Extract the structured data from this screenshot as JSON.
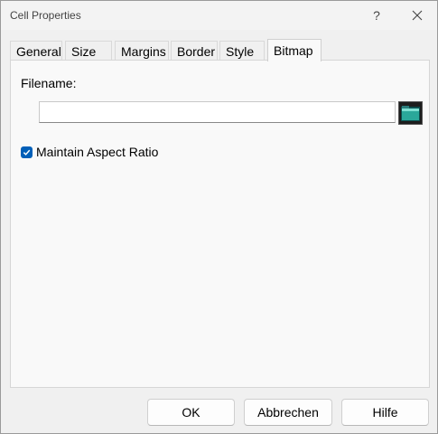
{
  "window": {
    "title": "Cell Properties",
    "help_glyph": "?"
  },
  "tabs": [
    {
      "label": "General",
      "active": false
    },
    {
      "label": "Size",
      "active": false
    },
    {
      "label": "Margins",
      "active": false
    },
    {
      "label": "Border",
      "active": false
    },
    {
      "label": "Style",
      "active": false
    },
    {
      "label": "Bitmap",
      "active": true
    }
  ],
  "bitmap": {
    "filename_label": "Filename:",
    "filename_value": "",
    "browse_icon": "folder-icon",
    "aspect_ratio_label": "Maintain Aspect Ratio",
    "aspect_ratio_checked": true
  },
  "buttons": {
    "ok": "OK",
    "cancel": "Abbrechen",
    "help": "Hilfe"
  },
  "colors": {
    "accent": "#005fb8",
    "panel": "#f9f9f9",
    "background": "#f0f0f0"
  }
}
